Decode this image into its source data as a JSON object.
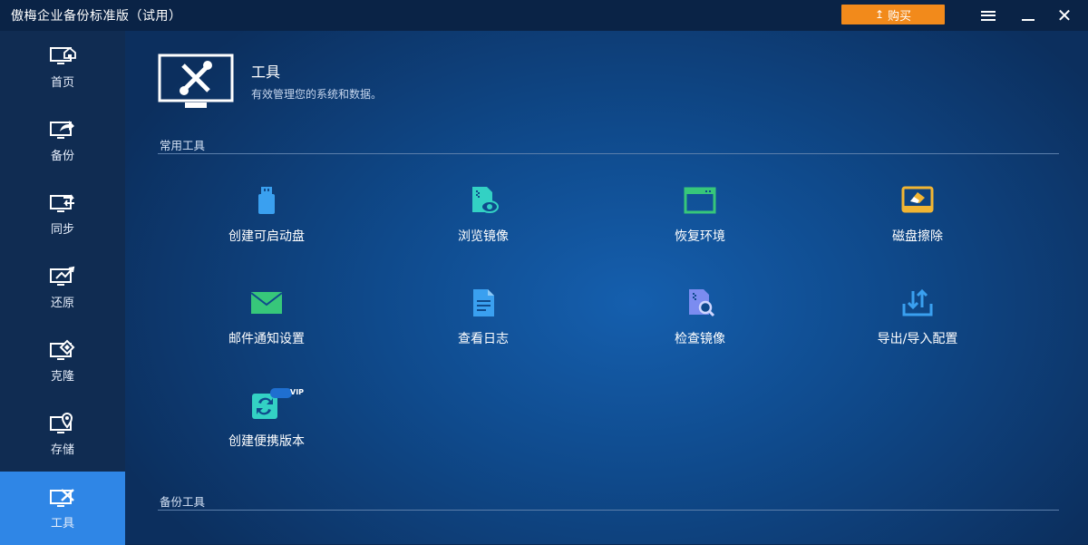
{
  "app": {
    "title": "傲梅企业备份标准版（试用）"
  },
  "titlebar": {
    "buy_label": "购买",
    "buy_arrow": "↥"
  },
  "sidebar": {
    "items": [
      {
        "label": "首页",
        "icon": "home-monitor-icon",
        "active": false
      },
      {
        "label": "备份",
        "icon": "backup-monitor-icon",
        "active": false
      },
      {
        "label": "同步",
        "icon": "sync-monitor-icon",
        "active": false
      },
      {
        "label": "还原",
        "icon": "restore-monitor-icon",
        "active": false
      },
      {
        "label": "克隆",
        "icon": "clone-monitor-icon",
        "active": false
      },
      {
        "label": "存储",
        "icon": "storage-location-icon",
        "active": false
      },
      {
        "label": "工具",
        "icon": "tools-monitor-icon",
        "active": true
      }
    ]
  },
  "header": {
    "title": "工具",
    "subtitle": "有效管理您的系统和数据。"
  },
  "sections": {
    "common": "常用工具",
    "backup": "备份工具"
  },
  "tools": [
    {
      "label": "创建可启动盘",
      "icon": "usb-drive-icon"
    },
    {
      "label": "浏览镜像",
      "icon": "explore-image-icon"
    },
    {
      "label": "恢复环境",
      "icon": "recovery-environment-icon"
    },
    {
      "label": "磁盘擦除",
      "icon": "disk-wipe-icon"
    },
    {
      "label": "邮件通知设置",
      "icon": "mail-icon"
    },
    {
      "label": "查看日志",
      "icon": "log-document-icon"
    },
    {
      "label": "检查镜像",
      "icon": "check-image-icon"
    },
    {
      "label": "导出/导入配置",
      "icon": "export-import-icon"
    },
    {
      "label": "创建便携版本",
      "icon": "portable-version-icon",
      "badge": "VIP"
    }
  ],
  "colors": {
    "accent": "#2f86e6",
    "buy": "#f28a1b",
    "teal": "#33d1c4",
    "green": "#37c77a",
    "yellow": "#f1b533",
    "blue": "#3aa0f0",
    "purple": "#7b8cf0"
  }
}
